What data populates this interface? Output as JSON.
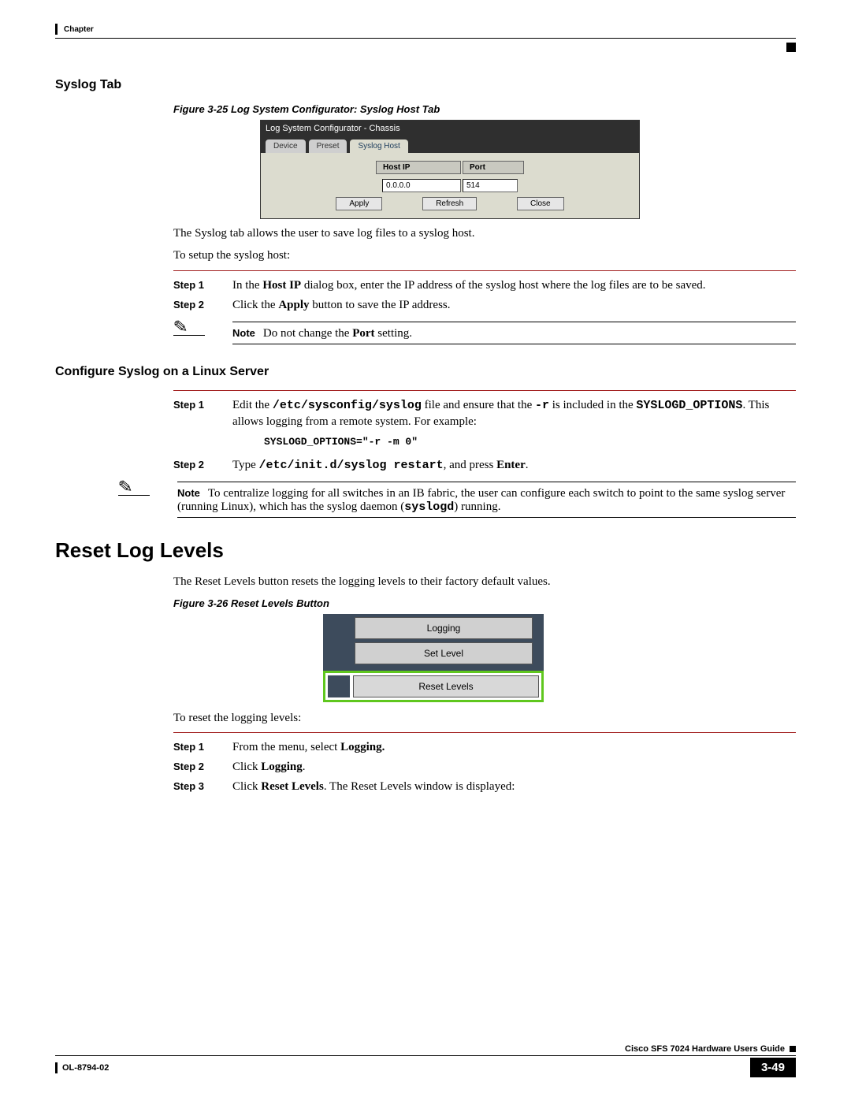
{
  "header_chapter": "Chapter",
  "syslog_heading": "Syslog Tab",
  "figure_25": "Figure 3-25    Log System Configurator: Syslog Host Tab",
  "dialog": {
    "title": "Log System Configurator - Chassis",
    "tabs": {
      "device": "Device",
      "preset": "Preset",
      "syslog": "Syslog Host"
    },
    "labels": {
      "host_ip": "Host IP",
      "port": "Port"
    },
    "values": {
      "host_ip": "0.0.0.0",
      "port": "514"
    },
    "buttons": {
      "apply": "Apply",
      "refresh": "Refresh",
      "close": "Close"
    }
  },
  "syslog_desc": "The Syslog tab allows the user to save log files to a syslog host.",
  "syslog_setup": "To setup the syslog host:",
  "step1_label": "Step 1",
  "step2_label": "Step 2",
  "step3_label": "Step 3",
  "syslog_step1_a": "In the ",
  "syslog_step1_b": "Host IP",
  "syslog_step1_c": " dialog box, enter the IP address of the syslog host where the log files are to be saved.",
  "syslog_step2_a": "Click the ",
  "syslog_step2_b": "Apply",
  "syslog_step2_c": " button to save the IP address.",
  "note_label": "Note",
  "note1_a": "Do not change the ",
  "note1_b": "Port",
  "note1_c": " setting.",
  "config_heading": "Configure Syslog on a Linux Server",
  "cfg_step1_a": "Edit the ",
  "cfg_step1_b": "/etc/sysconfig/syslog",
  "cfg_step1_c": " file and ensure that the ",
  "cfg_step1_d": "-r",
  "cfg_step1_e": " is included in the ",
  "cfg_step1_f": "SYSLOGD_OPTIONS",
  "cfg_step1_g": ". This allows logging from a remote system. For example:",
  "cfg_code": "SYSLOGD_OPTIONS=\"-r -m 0\"",
  "cfg_step2_a": "Type ",
  "cfg_step2_b": "/etc/init.d/syslog restart",
  "cfg_step2_c": ", and press ",
  "cfg_step2_d": "Enter",
  "cfg_step2_e": ".",
  "note2_a": "To centralize logging for all switches in an IB fabric, the user can configure each switch to point to the same syslog server (running Linux), which has the syslog daemon (",
  "note2_b": "syslogd",
  "note2_c": ") running.",
  "reset_heading": "Reset Log Levels",
  "reset_desc": "The Reset Levels button resets the logging levels to their factory default values.",
  "figure_26": "Figure 3-26    Reset Levels Button",
  "reset_buttons": {
    "logging": "Logging",
    "setlevel": "Set Level",
    "resetlevels": "Reset Levels"
  },
  "reset_to": "To reset the logging levels:",
  "reset_step1_a": "From the menu, select ",
  "reset_step1_b": "Logging.",
  "reset_step2_a": "Click ",
  "reset_step2_b": "Logging",
  "reset_step2_c": ".",
  "reset_step3_a": "Click ",
  "reset_step3_b": "Reset Levels",
  "reset_step3_c": ". The Reset Levels window is displayed:",
  "footer_guide": "Cisco SFS 7024 Hardware Users Guide",
  "footer_doc": "OL-8794-02",
  "page_num": "3-49"
}
